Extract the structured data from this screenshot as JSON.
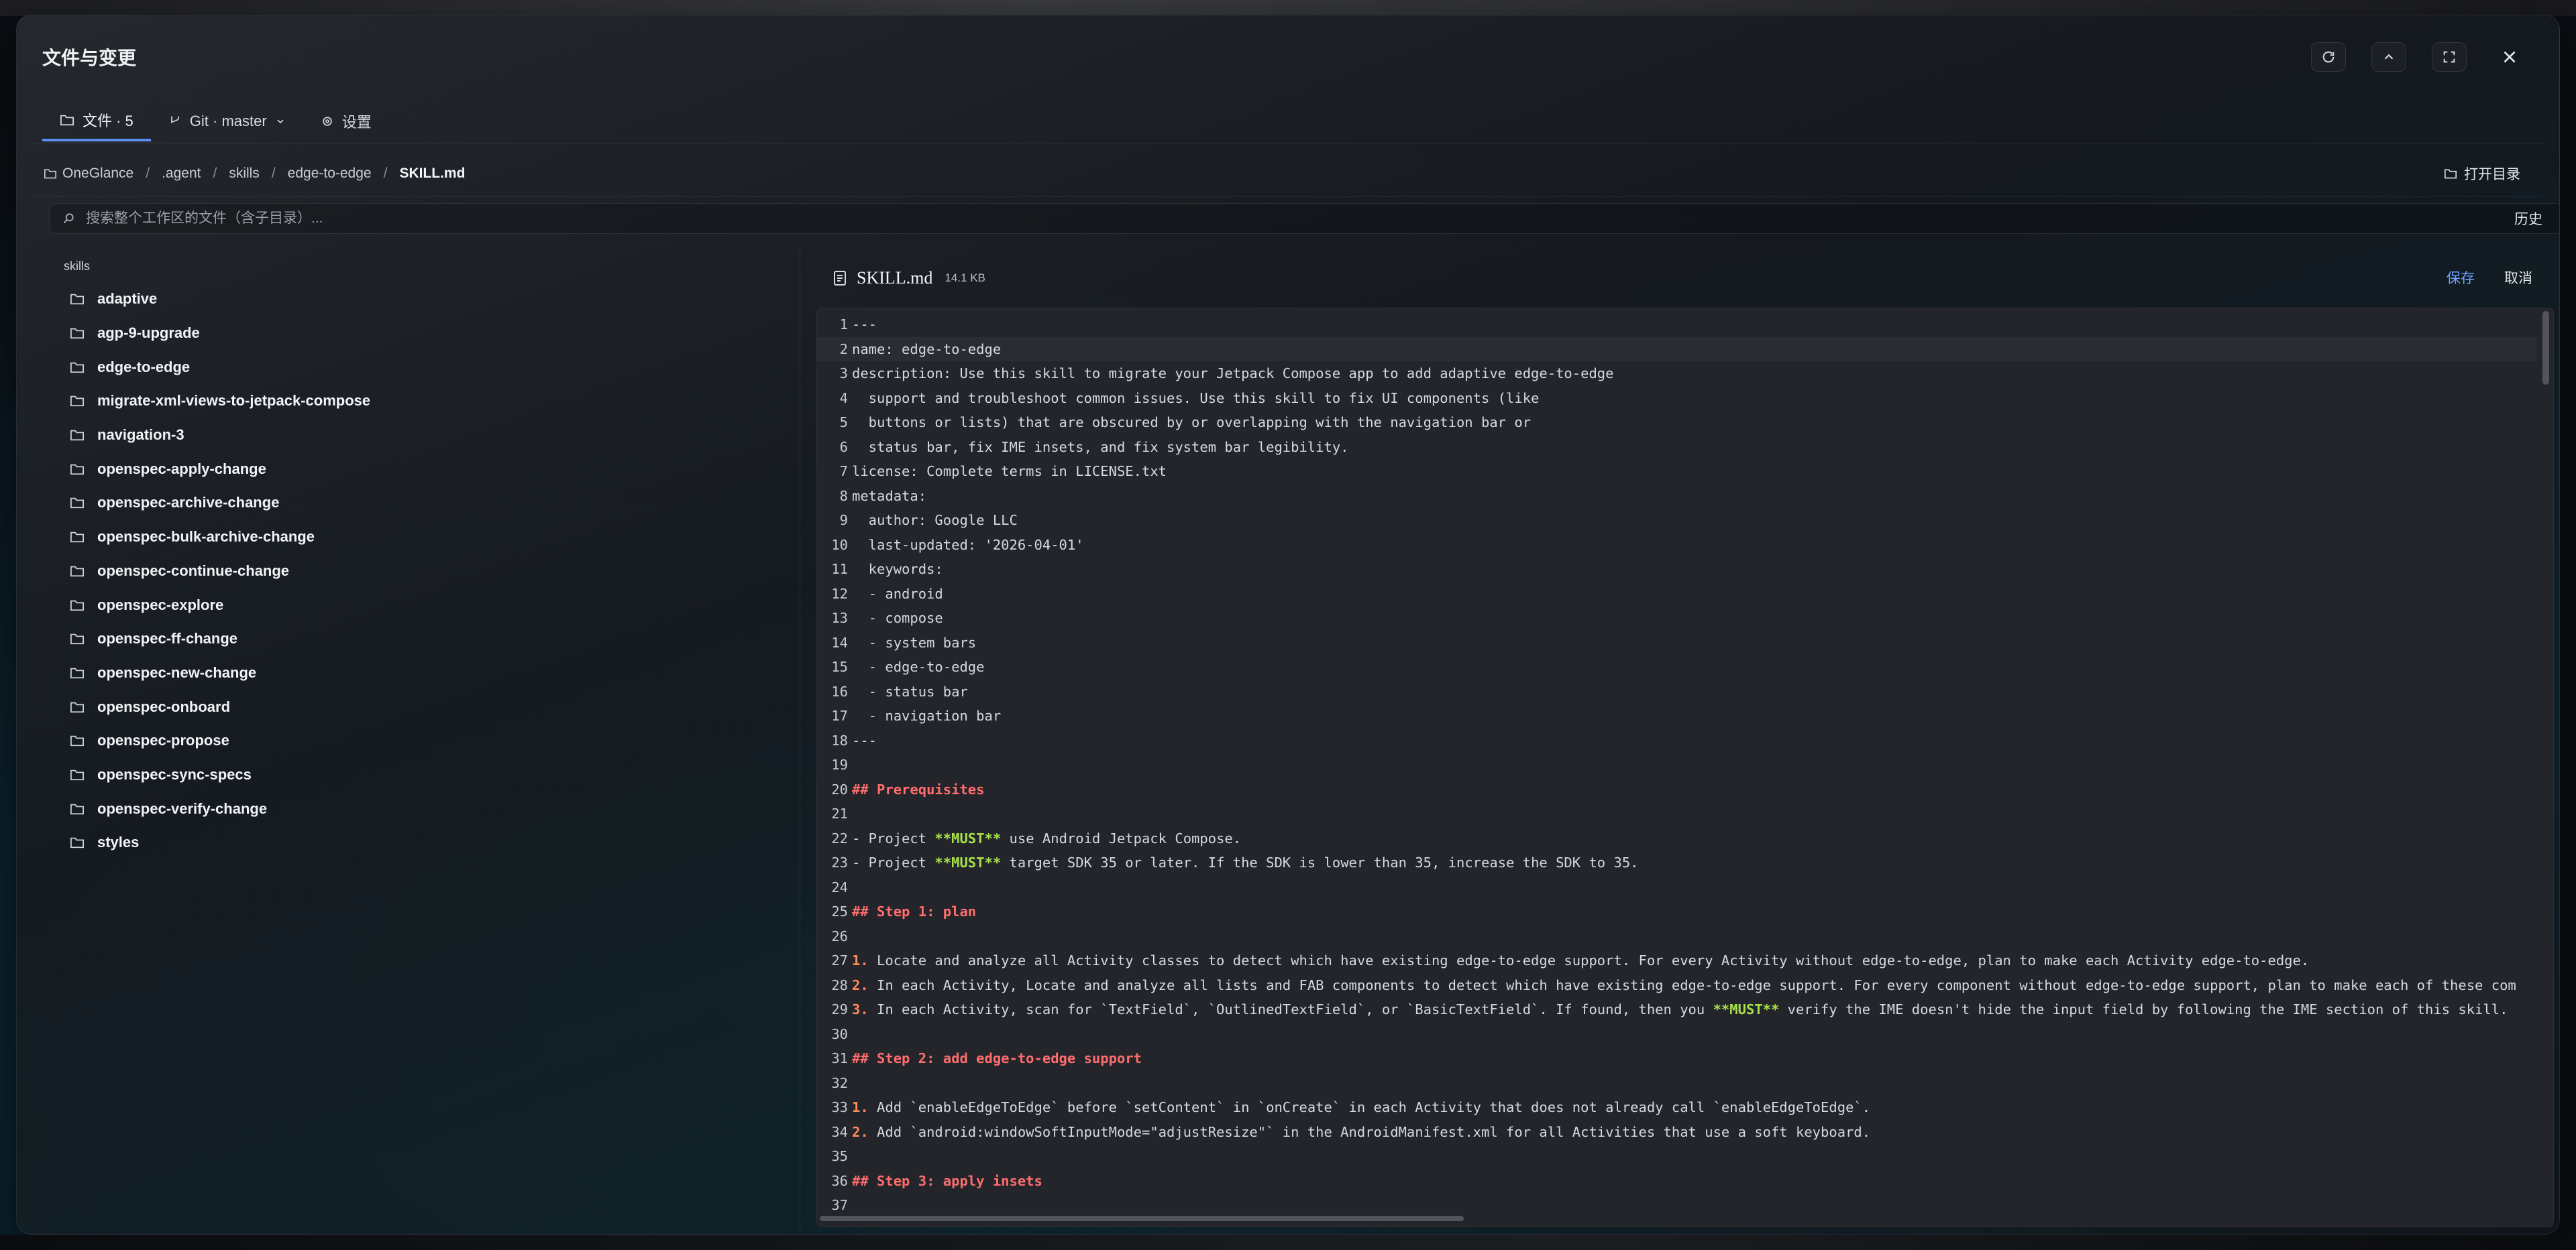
{
  "window": {
    "title": "文件与变更",
    "controls": {
      "refresh_icon": "refresh-icon",
      "collapse_icon": "chevron-up-icon",
      "maximize_icon": "maximize-icon",
      "close_icon": "close-icon"
    }
  },
  "tabs": [
    {
      "label": "文件 · 5",
      "icon": "folder-icon",
      "active": true
    },
    {
      "label": "Git · master",
      "icon": "git-branch-icon",
      "active": false
    },
    {
      "label": "设置",
      "icon": "gear-icon",
      "active": false
    }
  ],
  "breadcrumb": {
    "items": [
      "OneGlance",
      ".agent",
      "skills",
      "edge-to-edge",
      "SKILL.md"
    ],
    "open_dir_label": "打开目录"
  },
  "search": {
    "placeholder": "搜索整个工作区的文件（含子目录）...",
    "history_label": "历史"
  },
  "sidebar": {
    "root_label": "skills",
    "items": [
      "adaptive",
      "agp-9-upgrade",
      "edge-to-edge",
      "migrate-xml-views-to-jetpack-compose",
      "navigation-3",
      "openspec-apply-change",
      "openspec-archive-change",
      "openspec-bulk-archive-change",
      "openspec-continue-change",
      "openspec-explore",
      "openspec-ff-change",
      "openspec-new-change",
      "openspec-onboard",
      "openspec-propose",
      "openspec-sync-specs",
      "openspec-verify-change",
      "styles"
    ]
  },
  "editor": {
    "file_name": "SKILL.md",
    "file_size": "14.1 KB",
    "save_label": "保存",
    "cancel_label": "取消",
    "lines": [
      {
        "n": "1",
        "t": "---"
      },
      {
        "n": "2",
        "t": "name: edge-to-edge"
      },
      {
        "n": "3",
        "t": "description: Use this skill to migrate your Jetpack Compose app to add adaptive edge-to-edge"
      },
      {
        "n": "4",
        "t": "  support and troubleshoot common issues. Use this skill to fix UI components (like"
      },
      {
        "n": "5",
        "t": "  buttons or lists) that are obscured by or overlapping with the navigation bar or"
      },
      {
        "n": "6",
        "t": "  status bar, fix IME insets, and fix system bar legibility."
      },
      {
        "n": "7",
        "t": "license: Complete terms in LICENSE.txt"
      },
      {
        "n": "8",
        "t": "metadata:"
      },
      {
        "n": "9",
        "t": "  author: Google LLC"
      },
      {
        "n": "10",
        "t": "  last-updated: '2026-04-01'"
      },
      {
        "n": "11",
        "t": "  keywords:"
      },
      {
        "n": "12",
        "t": "  - android"
      },
      {
        "n": "13",
        "t": "  - compose"
      },
      {
        "n": "14",
        "t": "  - system bars"
      },
      {
        "n": "15",
        "t": "  - edge-to-edge"
      },
      {
        "n": "16",
        "t": "  - status bar"
      },
      {
        "n": "17",
        "t": "  - navigation bar"
      },
      {
        "n": "18",
        "t": "---"
      },
      {
        "n": "19",
        "t": ""
      },
      {
        "n": "20",
        "t": "## Prerequisites",
        "kind": "heading"
      },
      {
        "n": "21",
        "t": ""
      },
      {
        "n": "22",
        "pre": "- Project ",
        "bold": "**MUST**",
        "post": " use Android Jetpack Compose."
      },
      {
        "n": "23",
        "pre": "- Project ",
        "bold": "**MUST**",
        "post": " target SDK 35 or later. If the SDK is lower than 35, increase the SDK to 35."
      },
      {
        "n": "24",
        "t": ""
      },
      {
        "n": "25",
        "t": "## Step 1: plan",
        "kind": "heading"
      },
      {
        "n": "26",
        "t": ""
      },
      {
        "n": "27",
        "marker": "1.",
        "post": " Locate and analyze all Activity classes to detect which have existing edge-to-edge support. For every Activity without edge-to-edge, plan to make each Activity edge-to-edge."
      },
      {
        "n": "28",
        "marker": "2.",
        "post": " In each Activity, Locate and analyze all lists and FAB components to detect which have existing edge-to-edge support. For every component without edge-to-edge support, plan to make each of these com"
      },
      {
        "n": "29",
        "marker": "3.",
        "post": " In each Activity, scan for `TextField`, `OutlinedTextField`, or `BasicTextField`. If found, then you ",
        "bold": "**MUST**",
        "post2": " verify the IME doesn't hide the input field by following the IME section of this skill."
      },
      {
        "n": "30",
        "t": ""
      },
      {
        "n": "31",
        "t": "## Step 2: add edge-to-edge support",
        "kind": "heading"
      },
      {
        "n": "32",
        "t": ""
      },
      {
        "n": "33",
        "marker": "1.",
        "post": " Add `enableEdgeToEdge` before `setContent` in `onCreate` in each Activity that does not already call `enableEdgeToEdge`."
      },
      {
        "n": "34",
        "marker": "2.",
        "post": " Add `android:windowSoftInputMode=\"adjustResize\"` in the AndroidManifest.xml for all Activities that use a soft keyboard."
      },
      {
        "n": "35",
        "t": ""
      },
      {
        "n": "36",
        "t": "## Step 3: apply insets",
        "kind": "heading"
      },
      {
        "n": "37",
        "t": ""
      }
    ]
  }
}
